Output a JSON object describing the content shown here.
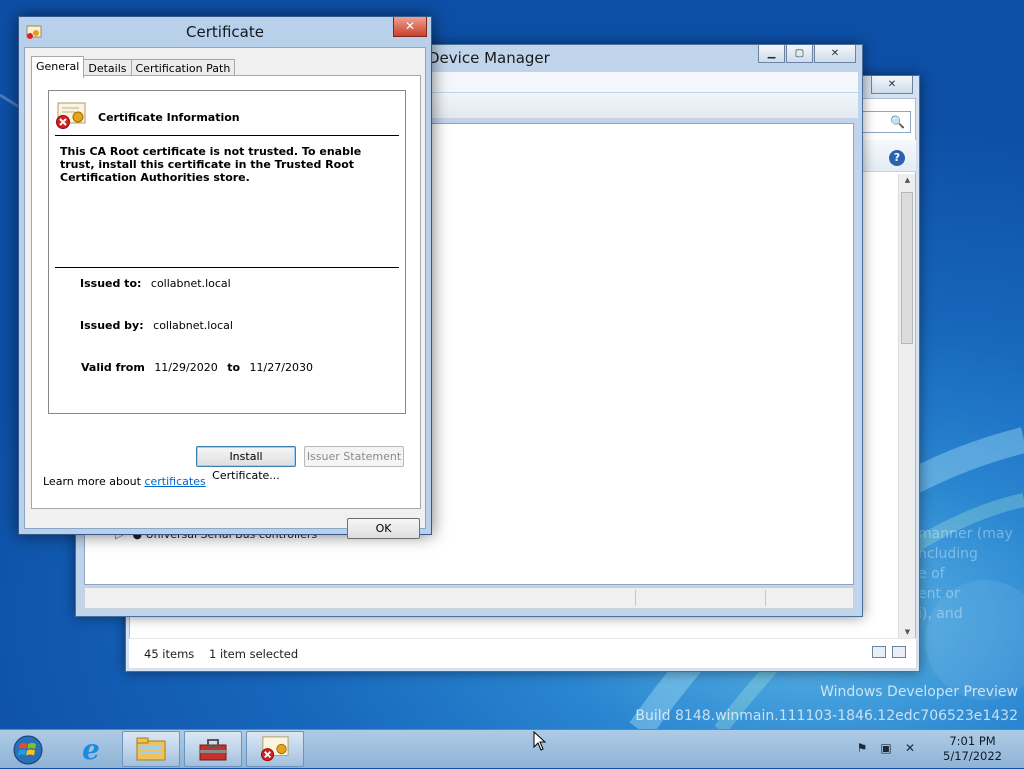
{
  "explorer": {
    "status_items": "45 items",
    "status_selected": "1 item selected"
  },
  "device_manager": {
    "title": "Device Manager",
    "visible_node": "Universal Serial Bus controllers"
  },
  "certificate": {
    "title": "Certificate",
    "tabs": [
      {
        "label": "General",
        "active": true
      },
      {
        "label": "Details",
        "active": false
      },
      {
        "label": "Certification Path",
        "active": false
      }
    ],
    "header": "Certificate Information",
    "warning": "This CA Root certificate is not trusted. To enable trust, install this certificate in the Trusted Root Certification Authorities store.",
    "issued_to_label": "Issued to:",
    "issued_to": "collabnet.local",
    "issued_by_label": "Issued by:",
    "issued_by": "collabnet.local",
    "valid_from_label": "Valid from",
    "valid_from": "11/29/2020",
    "valid_to_label": "to",
    "valid_to": "11/27/2030",
    "install_button": "Install Certificate...",
    "issuer_statement_button": "Issuer Statement",
    "learn_more_prefix": "Learn more about ",
    "learn_more_link": "certificates",
    "ok_button": "OK"
  },
  "desktop": {
    "watermark_line1": "Windows Developer Preview",
    "watermark_line2": "Build 8148.winmain.111103-1846.12edc706523e1432",
    "ghost_text": [
      "manner (may",
      "ncluding",
      "e of",
      "ent or",
      "i), and"
    ]
  },
  "taskbar": {
    "time": "7:01 PM",
    "date": "5/17/2022",
    "pinned": [
      "internet-explorer",
      "file-explorer",
      "toolbox",
      "certificate-manager"
    ]
  },
  "colors": {
    "accent": "#1767bd",
    "link": "#0066cc",
    "close": "#c8432b"
  }
}
